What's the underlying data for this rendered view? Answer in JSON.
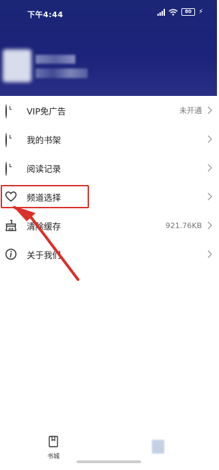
{
  "status_bar": {
    "time": "下午4:44",
    "battery": "80"
  },
  "menu": {
    "items": [
      {
        "label": "VIP免广告",
        "value": "未开通",
        "icon": "clock-icon"
      },
      {
        "label": "我的书架",
        "value": "",
        "icon": "clock-icon"
      },
      {
        "label": "阅读记录",
        "value": "",
        "icon": "clock-icon"
      },
      {
        "label": "频道选择",
        "value": "",
        "icon": "heart-icon"
      },
      {
        "label": "清除缓存",
        "value": "921.76KB",
        "icon": "broom-icon"
      },
      {
        "label": "关于我们",
        "value": "",
        "icon": "info-icon"
      }
    ]
  },
  "bottom_nav": {
    "bookstore_label": "书城"
  },
  "colors": {
    "header_bg": "#1c237a",
    "annotation_red": "#d9302a"
  }
}
